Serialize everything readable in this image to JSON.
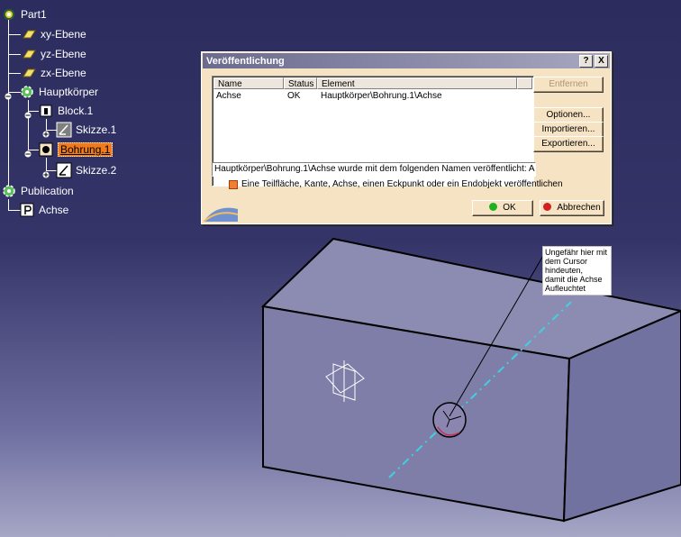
{
  "tree": {
    "items": [
      {
        "label": "Part1"
      },
      {
        "label": "xy-Ebene"
      },
      {
        "label": "yz-Ebene"
      },
      {
        "label": "zx-Ebene"
      },
      {
        "label": "Hauptkörper"
      },
      {
        "label": "Block.1"
      },
      {
        "label": "Skizze.1"
      },
      {
        "label": "Bohrung.1"
      },
      {
        "label": "Skizze.2"
      },
      {
        "label": "Publication"
      },
      {
        "label": "Achse"
      }
    ]
  },
  "dialog": {
    "title": "Veröffentlichung",
    "help_label": "?",
    "close_label": "X",
    "columns": [
      "Name",
      "Status",
      "Element"
    ],
    "rows": [
      {
        "name": "Achse",
        "status": "OK",
        "element": "Hauptkörper\\Bohrung.1\\Achse"
      }
    ],
    "status_text": "Hauptkörper\\Bohrung.1\\Achse wurde mit dem folgenden Namen veröffentlicht: Achse",
    "hint": "Eine Teilfläche, Kante, Achse, einen Eckpunkt oder ein Endobjekt veröffentlichen",
    "buttons": {
      "remove": "Entfernen",
      "options": "Optionen...",
      "import": "Importieren...",
      "export": "Exportieren...",
      "ok": "OK",
      "cancel": "Abbrechen"
    }
  },
  "annotation": {
    "lines": [
      "Ungefähr hier mit",
      "dem Cursor",
      "hindeuten,",
      "damit die Achse",
      "Aufleuchtet"
    ]
  },
  "colors": {
    "selection": "#f07a1c",
    "axis": "#40d0e0",
    "dialog_bg": "#f6e3c3"
  }
}
